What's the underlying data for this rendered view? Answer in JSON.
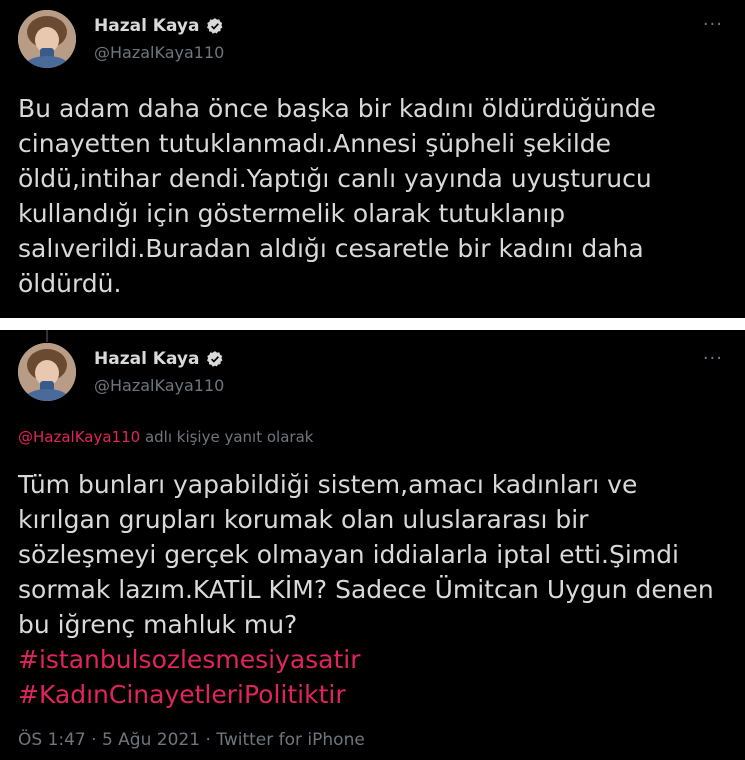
{
  "tweet1": {
    "author_name": "Hazal Kaya",
    "handle": "@HazalKaya110",
    "more_label": "···",
    "text": "Bu adam daha önce başka bir kadını öldürdüğünde\ncinayetten tutuklanmadı.Annesi şüpheli şekilde\nöldü,intihar dendi.Yaptığı canlı yayında uyuşturucu\nkullandığı için göstermelik olarak tutuklanıp\nsalıverildi.Buradan aldığı cesaretle bir kadını daha\nöldürdü."
  },
  "tweet2": {
    "author_name": "Hazal Kaya",
    "handle": "@HazalKaya110",
    "more_label": "···",
    "reply_mention": "@HazalKaya110",
    "reply_suffix": " adlı kişiye yanıt olarak",
    "text": "Tüm bunları yapabildiği sistem,amacı kadınları ve\nkırılgan grupları korumak olan uluslararası bir\nsözleşmeyi gerçek olmayan iddialarla iptal etti.Şimdi\nsormak lazım.KATİL KİM? Sadece Ümitcan Uygun denen\nbu iğrenç mahluk mu?",
    "hashtags": [
      "#istanbulsozlesmesiyasatir",
      "#KadınCinayetleriPolitiktir"
    ],
    "timestamp": "ÖS 1:47 · 5 Ağu 2021 · Twitter for iPhone"
  },
  "colors": {
    "background": "#000000",
    "text": "#d9d9d9",
    "secondary": "#6e767d",
    "accent": "#e0245e"
  },
  "icons": [
    "verified-badge-icon",
    "more-options-icon"
  ]
}
